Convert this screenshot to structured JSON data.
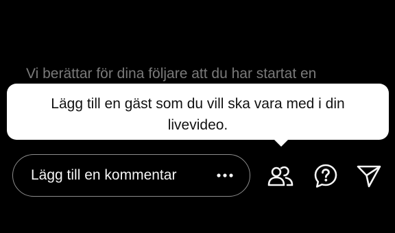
{
  "live": {
    "status_message": "Vi berättar för dina följare att du har startat en"
  },
  "tooltip": {
    "text": "Lägg till en gäst som du vill ska vara med i din livevideo."
  },
  "comment_bar": {
    "placeholder": "Lägg till en kommentar",
    "more_icon": "more-horizontal-icon"
  },
  "actions": [
    {
      "icon": "add-guests-icon"
    },
    {
      "icon": "help-question-icon"
    },
    {
      "icon": "send-paper-plane-icon"
    }
  ],
  "colors": {
    "background": "#000000",
    "tooltip_bg": "#ffffff",
    "tooltip_text": "#111111",
    "muted_text": "#7a7a7a",
    "foreground": "#f5f5f5",
    "pill_border": "#8e8e8e"
  }
}
